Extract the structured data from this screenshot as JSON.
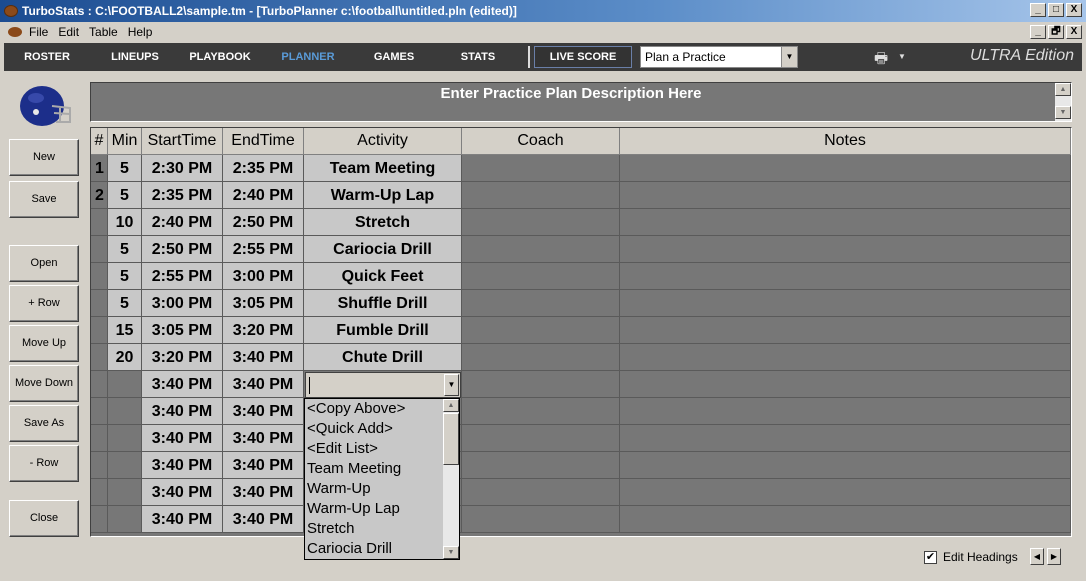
{
  "window": {
    "title": "TurboStats : C:\\FOOTBALL2\\sample.tm - [TurboPlanner c:\\football\\untitled.pln (edited)]",
    "controls": [
      "_",
      "□",
      "X"
    ],
    "mdi_controls": [
      "_",
      "🗗",
      "X"
    ]
  },
  "menu": {
    "items": [
      "File",
      "Edit",
      "Table",
      "Help"
    ]
  },
  "nav": {
    "items": [
      "ROSTER",
      "LINEUPS",
      "PLAYBOOK",
      "PLANNER",
      "GAMES",
      "STATS"
    ],
    "active": "PLANNER",
    "live_score": "LIVE SCORE",
    "plan_select": "Plan a Practice",
    "edition": "ULTRA Edition"
  },
  "sidebar": {
    "buttons": [
      "New",
      "Save",
      "Open",
      "+ Row",
      "Move Up",
      "Move Down",
      "Save As",
      "- Row",
      "Close"
    ]
  },
  "description": {
    "text": "Enter Practice Plan Description Here"
  },
  "grid": {
    "columns": [
      "#",
      "Min",
      "StartTime",
      "EndTime",
      "Activity",
      "Coach",
      "Notes"
    ],
    "rows": [
      {
        "num": "1",
        "min": "5",
        "start": "2:30 PM",
        "end": "2:35 PM",
        "activity": "Team Meeting"
      },
      {
        "num": "2",
        "min": "5",
        "start": "2:35 PM",
        "end": "2:40 PM",
        "activity": "Warm-Up Lap"
      },
      {
        "num": "",
        "min": "10",
        "start": "2:40 PM",
        "end": "2:50 PM",
        "activity": "Stretch"
      },
      {
        "num": "",
        "min": "5",
        "start": "2:50 PM",
        "end": "2:55 PM",
        "activity": "Cariocia Drill"
      },
      {
        "num": "",
        "min": "5",
        "start": "2:55 PM",
        "end": "3:00 PM",
        "activity": "Quick Feet"
      },
      {
        "num": "",
        "min": "5",
        "start": "3:00 PM",
        "end": "3:05 PM",
        "activity": "Shuffle Drill"
      },
      {
        "num": "",
        "min": "15",
        "start": "3:05 PM",
        "end": "3:20 PM",
        "activity": "Fumble Drill"
      },
      {
        "num": "",
        "min": "20",
        "start": "3:20 PM",
        "end": "3:40 PM",
        "activity": "Chute Drill"
      },
      {
        "num": "",
        "min": "",
        "start": "3:40 PM",
        "end": "3:40 PM",
        "activity": ""
      },
      {
        "num": "",
        "min": "",
        "start": "3:40 PM",
        "end": "3:40 PM",
        "activity": ""
      },
      {
        "num": "",
        "min": "",
        "start": "3:40 PM",
        "end": "3:40 PM",
        "activity": ""
      },
      {
        "num": "",
        "min": "",
        "start": "3:40 PM",
        "end": "3:40 PM",
        "activity": ""
      },
      {
        "num": "",
        "min": "",
        "start": "3:40 PM",
        "end": "3:40 PM",
        "activity": ""
      },
      {
        "num": "",
        "min": "",
        "start": "3:40 PM",
        "end": "3:40 PM",
        "activity": ""
      }
    ]
  },
  "dropdown": {
    "options": [
      "<Copy Above>",
      "<Quick Add>",
      "<Edit List>",
      "Team Meeting",
      "Warm-Up",
      "Warm-Up Lap",
      "Stretch",
      "Cariocia Drill"
    ]
  },
  "footer": {
    "edit_headings_label": "Edit Headings",
    "edit_headings_checked": true
  }
}
